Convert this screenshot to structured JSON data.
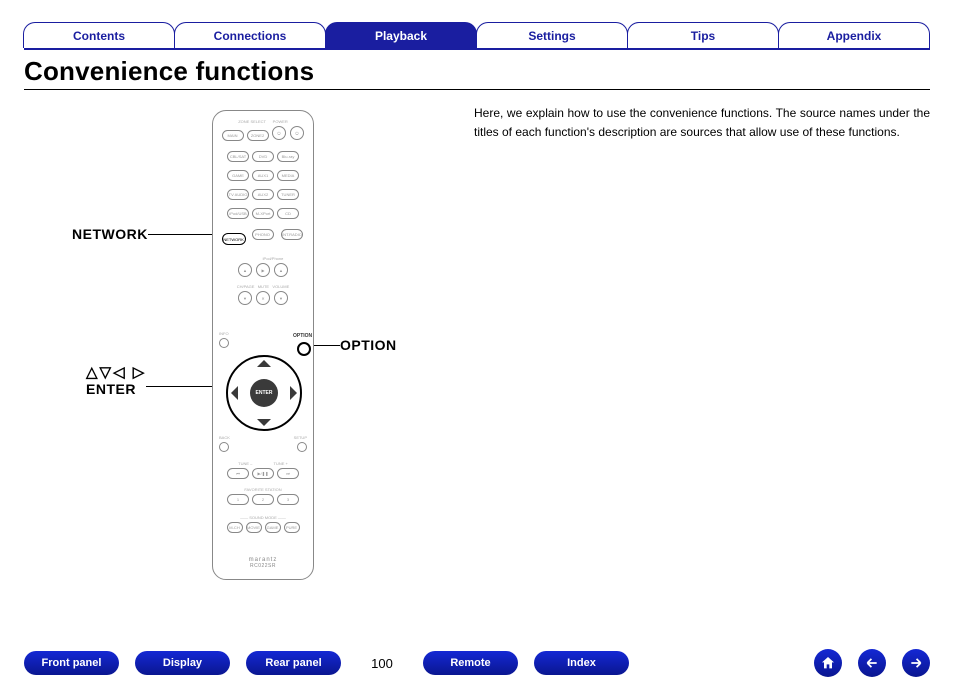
{
  "tabs": {
    "items": [
      {
        "label": "Contents",
        "active": false
      },
      {
        "label": "Connections",
        "active": false
      },
      {
        "label": "Playback",
        "active": true
      },
      {
        "label": "Settings",
        "active": false
      },
      {
        "label": "Tips",
        "active": false
      },
      {
        "label": "Appendix",
        "active": false
      }
    ]
  },
  "page_title": "Convenience functions",
  "intro_text": "Here, we explain how to use the convenience functions. The source names under the titles of each function's description are sources that allow use of these functions.",
  "annotations": {
    "network": "NETWORK",
    "option": "OPTION",
    "enter_symbols": "△▽◁ ▷",
    "enter": "ENTER"
  },
  "remote": {
    "highlight_button": "NETWORK",
    "option_label": "OPTION",
    "dpad_center": "ENTER",
    "brand": "marantz",
    "model": "RC022SR"
  },
  "footer": {
    "buttons": {
      "front_panel": "Front panel",
      "display": "Display",
      "rear_panel": "Rear panel",
      "remote": "Remote",
      "index": "Index"
    },
    "page_number": "100"
  }
}
